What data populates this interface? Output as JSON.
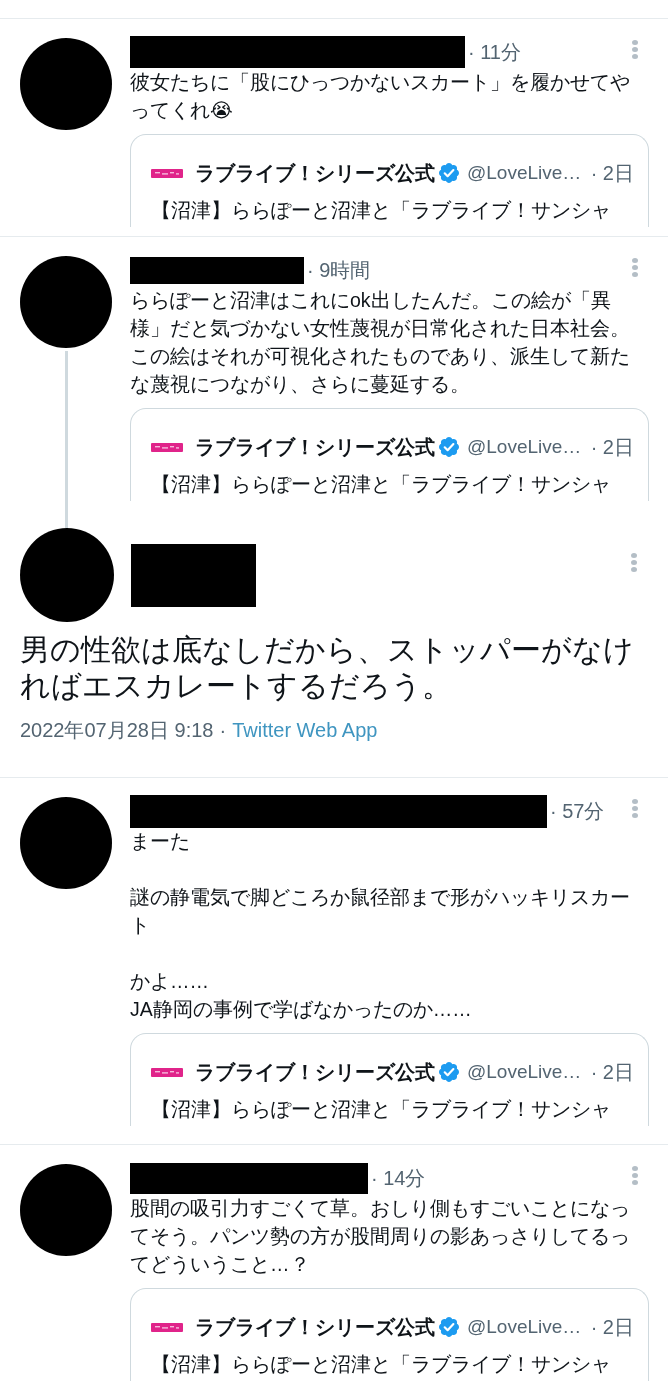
{
  "tweets": [
    {
      "kind": "reply",
      "time": "· 11分",
      "paragraphs": [
        [
          "彼女たちに「股にひっつかないスカート」を履かせてやってくれ😭"
        ]
      ],
      "thread_below": false,
      "quote": {
        "name": "ラブライブ！シリーズ公式",
        "verified": true,
        "handle": "@LoveLive…",
        "time": "· 2日",
        "text": "【沼津】ららぽーと沼津と「ラブライブ！サンシャ"
      }
    },
    {
      "kind": "reply",
      "time": "· 9時間",
      "paragraphs": [
        [
          "ららぽーと沼津はこれにok出したんだ。この絵が「異様」だと気づかない女性蔑視が日常化された日本社会。この絵はそれが可視化されたものであり、派生して新たな蔑視につながり、さらに蔓延する。"
        ]
      ],
      "thread_below": true,
      "quote": {
        "name": "ラブライブ！シリーズ公式",
        "verified": true,
        "handle": "@LoveLive…",
        "time": "· 2日",
        "text": "【沼津】ららぽーと沼津と「ラブライブ！サンシャ"
      }
    },
    {
      "kind": "focal",
      "text": "男の性欲は底なしだから、ストッパーがなければエスカレートするだろう。",
      "date": "2022年07月28日 9:18",
      "separator": "·",
      "source": "Twitter Web App",
      "thread_below": false
    },
    {
      "kind": "reply",
      "time": "· 57分",
      "paragraphs": [
        [
          "まーた"
        ],
        [
          "謎の静電気で脚どころか鼠径部まで形がハッキリスカート"
        ],
        [
          "かよ……",
          "JA静岡の事例で学ばなかったのか……"
        ]
      ],
      "thread_below": false,
      "quote": {
        "name": "ラブライブ！シリーズ公式",
        "verified": true,
        "handle": "@LoveLive…",
        "time": "· 2日",
        "text": "【沼津】ららぽーと沼津と「ラブライブ！サンシャ"
      }
    },
    {
      "kind": "reply",
      "time": "· 14分",
      "paragraphs": [
        [
          "股間の吸引力すごくて草。おしり側もすごいことになってそう。パンツ勢の方が股間周りの影あっさりしてるってどういうこと…？"
        ]
      ],
      "thread_below": false,
      "quote": {
        "name": "ラブライブ！シリーズ公式",
        "verified": true,
        "handle": "@LoveLive…",
        "time": "· 2日",
        "text": "【沼津】ららぽーと沼津と「ラブライブ！サンシャ"
      }
    }
  ]
}
